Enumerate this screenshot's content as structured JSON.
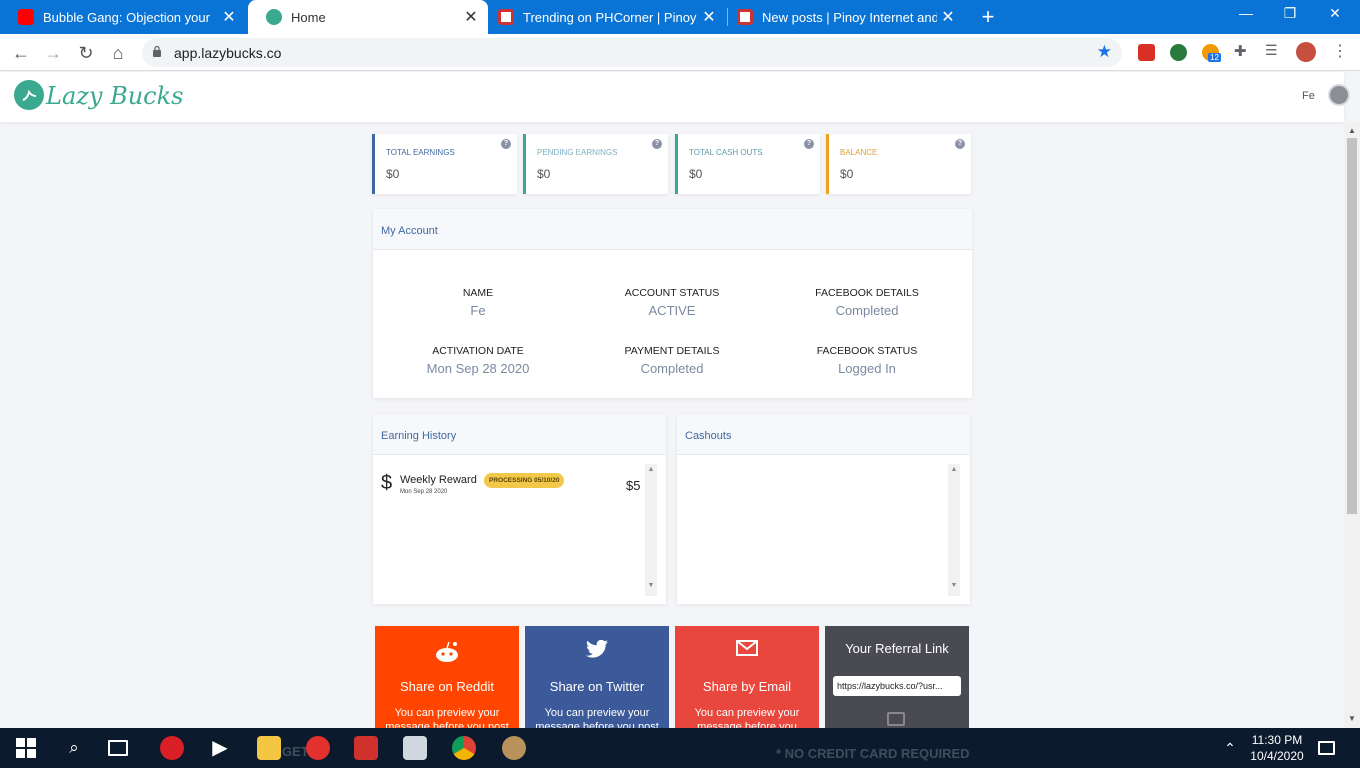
{
  "browser": {
    "tabs": [
      {
        "title": "Bubble Gang: Objection your",
        "active": false,
        "favicon": "youtube-icon",
        "color": "#ff0000"
      },
      {
        "title": "Home",
        "active": true,
        "favicon": "lazybucks-icon",
        "color": "#3aa98f"
      },
      {
        "title": "Trending on PHCorner | Pinoy Int",
        "active": false,
        "favicon": "phcorner-icon",
        "color": "#cc3333"
      },
      {
        "title": "New posts | Pinoy Internet and Te",
        "active": false,
        "favicon": "phcorner-icon",
        "color": "#cc3333"
      }
    ],
    "address": "app.lazybucks.co",
    "extension_badge": "12"
  },
  "site": {
    "logo_text": "Lazy Bucks",
    "user_name": "Fe"
  },
  "stats": [
    {
      "label": "TOTAL EARNINGS",
      "value": "$0",
      "color": "#3f6aa0",
      "border": "#3f6aa0"
    },
    {
      "label": "PENDING EARNINGS",
      "value": "$0",
      "color": "#7fb0c4",
      "border": "#3aa98f"
    },
    {
      "label": "TOTAL CASH OUTS",
      "value": "$0",
      "color": "#5d9aaa",
      "border": "#3aa98f"
    },
    {
      "label": "BALANCE",
      "value": "$0",
      "color": "#e0a030",
      "border": "#f0a020"
    }
  ],
  "account": {
    "title": "My Account",
    "fields": [
      {
        "label": "NAME",
        "value": "Fe"
      },
      {
        "label": "ACCOUNT STATUS",
        "value": "ACTIVE"
      },
      {
        "label": "FACEBOOK DETAILS",
        "value": "Completed"
      },
      {
        "label": "ACTIVATION DATE",
        "value": "Mon Sep 28 2020"
      },
      {
        "label": "PAYMENT DETAILS",
        "value": "Completed"
      },
      {
        "label": "FACEBOOK STATUS",
        "value": "Logged In"
      }
    ]
  },
  "earning_history": {
    "title": "Earning History",
    "items": [
      {
        "currency": "$",
        "name": "Weekly Reward",
        "badge": "PROCESSING 05/10/20",
        "date": "Mon Sep 28 2020",
        "amount": "$5"
      }
    ]
  },
  "cashouts": {
    "title": "Cashouts"
  },
  "share": {
    "reddit": {
      "title": "Share on Reddit",
      "subtitle": "You can preview your message before you post",
      "color": "#ff4500"
    },
    "twitter": {
      "title": "Share on Twitter",
      "subtitle": "You can preview your message before you post",
      "color": "#3c5a99"
    },
    "email": {
      "title": "Share by Email",
      "subtitle": "You can preview your message before you send it",
      "color": "#e8473d"
    },
    "referral": {
      "title": "Your Referral Link",
      "link": "https://lazybucks.co/?usr...",
      "color": "#4a4b52"
    }
  },
  "taskbar": {
    "time": "11:30 PM",
    "date": "10/4/2020",
    "wallpaper_text": "* NO CREDIT CARD REQUIRED",
    "wallpaper_text_2": "GET ID"
  }
}
